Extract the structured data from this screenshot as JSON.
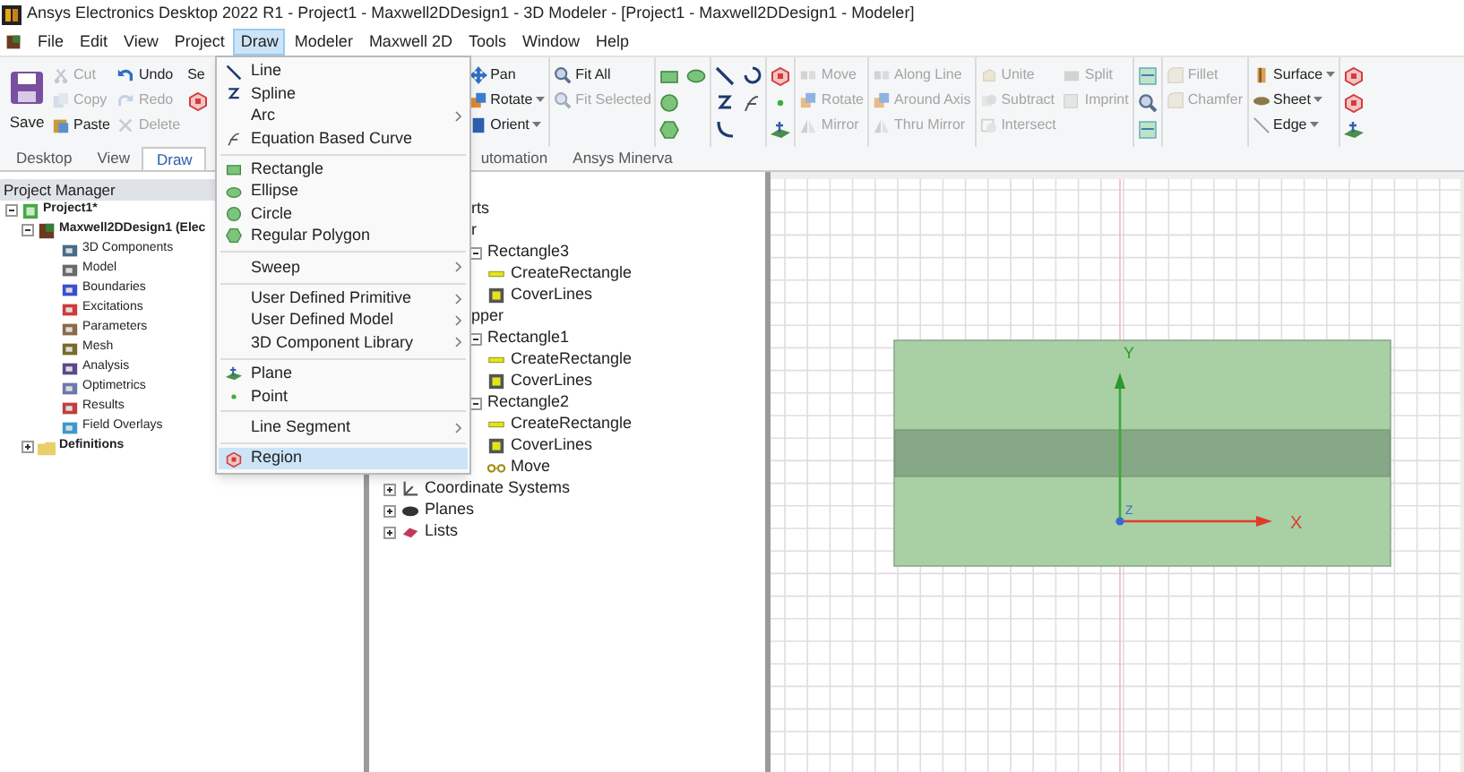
{
  "window": {
    "title": "Ansys Electronics Desktop 2022 R1 - Project1 - Maxwell2DDesign1 - 3D Modeler - [Project1 - Maxwell2DDesign1 - Modeler]"
  },
  "menu_bar": [
    {
      "label": "File",
      "selected": false
    },
    {
      "label": "Edit",
      "selected": false
    },
    {
      "label": "View",
      "selected": false
    },
    {
      "label": "Project",
      "selected": false
    },
    {
      "label": "Draw",
      "selected": true
    },
    {
      "label": "Modeler",
      "selected": false
    },
    {
      "label": "Maxwell 2D",
      "selected": false
    },
    {
      "label": "Tools",
      "selected": false
    },
    {
      "label": "Window",
      "selected": false
    },
    {
      "label": "Help",
      "selected": false
    }
  ],
  "ribbon": [
    {
      "sep": false,
      "items": [
        {
          "kind": "save",
          "label": "Save",
          "disabled": false,
          "large": true
        }
      ]
    },
    {
      "sep": false,
      "items": [
        {
          "kind": "cut",
          "label": "Cut",
          "disabled": true
        },
        {
          "kind": "copy",
          "label": "Copy",
          "disabled": true
        },
        {
          "kind": "paste",
          "label": "Paste",
          "disabled": false
        }
      ]
    },
    {
      "sep": false,
      "items": [
        {
          "kind": "undo",
          "label": "Undo",
          "disabled": false
        },
        {
          "kind": "redo",
          "label": "Redo",
          "disabled": true
        },
        {
          "kind": "delete",
          "label": "Delete",
          "disabled": true
        }
      ]
    },
    {
      "sep": false,
      "items": [
        {
          "kind": "none",
          "label": "Se",
          "disabled": false
        },
        {
          "kind": "region",
          "disabled": false
        }
      ]
    },
    {
      "sep": false,
      "gap": true,
      "items": [
        {
          "kind": "pan",
          "label": "Pan",
          "disabled": false
        },
        {
          "kind": "rotate",
          "label": "Rotate",
          "disabled": false,
          "dropdown": true
        },
        {
          "kind": "orient",
          "label": "Orient",
          "disabled": false,
          "dropdown": true
        }
      ]
    },
    {
      "sep": true,
      "items": [
        {
          "kind": "zoom",
          "label": "Fit All",
          "disabled": false
        },
        {
          "kind": "zoom",
          "label": "Fit Selected",
          "disabled": true
        }
      ]
    },
    {
      "sep": true,
      "items": [
        {
          "kind": "rect",
          "disabled": false
        },
        {
          "kind": "circle",
          "disabled": false
        },
        {
          "kind": "polygon",
          "disabled": false
        }
      ]
    },
    {
      "sep": false,
      "items": [
        {
          "kind": "ellipse",
          "disabled": false
        }
      ]
    },
    {
      "sep": true,
      "items": [
        {
          "kind": "line",
          "disabled": false
        },
        {
          "kind": "spline",
          "disabled": false
        },
        {
          "kind": "arc",
          "disabled": false
        }
      ]
    },
    {
      "sep": false,
      "items": [
        {
          "kind": "arc3",
          "disabled": false
        },
        {
          "kind": "equation",
          "disabled": false
        }
      ]
    },
    {
      "sep": true,
      "items": [
        {
          "kind": "region",
          "disabled": false
        },
        {
          "kind": "point",
          "disabled": false
        },
        {
          "kind": "plane",
          "disabled": false
        }
      ]
    },
    {
      "sep": true,
      "items": [
        {
          "kind": "move",
          "label": "Move",
          "disabled": true
        },
        {
          "kind": "rotate",
          "label": "Rotate",
          "disabled": true
        },
        {
          "kind": "mirror",
          "label": "Mirror",
          "disabled": true
        }
      ]
    },
    {
      "sep": true,
      "items": [
        {
          "kind": "move",
          "label": "Along Line",
          "disabled": true
        },
        {
          "kind": "rotate",
          "label": "Around Axis",
          "disabled": true
        },
        {
          "kind": "mirror",
          "label": "Thru Mirror",
          "disabled": true
        }
      ]
    },
    {
      "sep": true,
      "items": [
        {
          "kind": "unite",
          "label": "Unite",
          "disabled": true
        },
        {
          "kind": "subtract",
          "label": "Subtract",
          "disabled": true
        },
        {
          "kind": "intersect",
          "label": "Intersect",
          "disabled": true
        }
      ]
    },
    {
      "sep": false,
      "items": [
        {
          "kind": "split",
          "label": "Split",
          "disabled": true
        },
        {
          "kind": "imprint",
          "label": "Imprint",
          "disabled": true
        }
      ]
    },
    {
      "sep": true,
      "items": [
        {
          "kind": "view",
          "disabled": false
        },
        {
          "kind": "zoom",
          "disabled": false
        },
        {
          "kind": "view",
          "disabled": false
        }
      ]
    },
    {
      "sep": true,
      "items": [
        {
          "kind": "fillet",
          "label": "Fillet",
          "disabled": true
        },
        {
          "kind": "fillet",
          "label": "Chamfer",
          "disabled": true
        }
      ]
    },
    {
      "sep": true,
      "items": [
        {
          "kind": "surface",
          "label": "Surface",
          "disabled": false,
          "dropdown": true
        },
        {
          "kind": "sheet",
          "label": "Sheet",
          "disabled": false,
          "dropdown": true
        },
        {
          "kind": "edge",
          "label": "Edge",
          "disabled": false,
          "dropdown": true
        }
      ]
    },
    {
      "sep": true,
      "items": [
        {
          "kind": "region",
          "disabled": false
        },
        {
          "kind": "region",
          "disabled": false
        },
        {
          "kind": "plane",
          "disabled": false
        }
      ]
    }
  ],
  "ribbon_tabs": [
    {
      "label": "Desktop",
      "selected": false
    },
    {
      "label": "View",
      "selected": false
    },
    {
      "label": "Draw",
      "selected": true
    },
    {
      "label": "utomation",
      "selected": false,
      "gap": true
    },
    {
      "label": "Ansys Minerva",
      "selected": false
    }
  ],
  "project_manager": {
    "title": "Project Manager",
    "tree": [
      {
        "label": "Project1*",
        "kind": "project",
        "expanded": true,
        "children": [
          {
            "label": "Maxwell2DDesign1 (Elec",
            "kind": "design",
            "expanded": true,
            "children": [
              {
                "label": "3D Components",
                "kind": "components"
              },
              {
                "label": "Model",
                "kind": "model"
              },
              {
                "label": "Boundaries",
                "kind": "boundaries"
              },
              {
                "label": "Excitations",
                "kind": "excitations"
              },
              {
                "label": "Parameters",
                "kind": "parameters"
              },
              {
                "label": "Mesh",
                "kind": "mesh"
              },
              {
                "label": "Analysis",
                "kind": "analysis"
              },
              {
                "label": "Optimetrics",
                "kind": "optimetrics"
              },
              {
                "label": "Results",
                "kind": "results"
              },
              {
                "label": "Field Overlays",
                "kind": "overlays"
              }
            ]
          },
          {
            "label": "Definitions",
            "kind": "folder",
            "expanded": false
          }
        ]
      }
    ]
  },
  "model_tree": [
    {
      "label": "rts",
      "kind": "fragment",
      "children": [
        {
          "label": "r",
          "kind": "fragment",
          "children": [
            {
              "label": "Rectangle3",
              "kind": "node",
              "expanded": true,
              "children": [
                {
                  "label": "CreateRectangle",
                  "kind": "create"
                },
                {
                  "label": "CoverLines",
                  "kind": "cover"
                }
              ]
            }
          ]
        },
        {
          "label": "pper",
          "kind": "fragment",
          "children": [
            {
              "label": "Rectangle1",
              "kind": "node",
              "expanded": true,
              "children": [
                {
                  "label": "CreateRectangle",
                  "kind": "create"
                },
                {
                  "label": "CoverLines",
                  "kind": "cover"
                }
              ]
            },
            {
              "label": "Rectangle2",
              "kind": "node",
              "expanded": true,
              "children": [
                {
                  "label": "CreateRectangle",
                  "kind": "create"
                },
                {
                  "label": "CoverLines",
                  "kind": "cover"
                },
                {
                  "label": "Move",
                  "kind": "move"
                }
              ]
            }
          ]
        }
      ]
    },
    {
      "label": "Coordinate Systems",
      "kind": "coords",
      "expanded": false
    },
    {
      "label": "Planes",
      "kind": "planes",
      "expanded": false
    },
    {
      "label": "Lists",
      "kind": "lists",
      "expanded": false
    }
  ],
  "draw_menu": [
    {
      "kind": "line",
      "label": "Line",
      "submenu": false,
      "selected": false
    },
    {
      "kind": "spline",
      "label": "Spline",
      "submenu": false,
      "selected": false
    },
    {
      "kind": "none",
      "label": "Arc",
      "submenu": true,
      "selected": false
    },
    {
      "kind": "equation",
      "label": "Equation Based Curve",
      "submenu": false,
      "selected": false
    },
    {
      "kind": "separator"
    },
    {
      "kind": "rect",
      "label": "Rectangle",
      "submenu": false,
      "selected": false
    },
    {
      "kind": "ellipse",
      "label": "Ellipse",
      "submenu": false,
      "selected": false
    },
    {
      "kind": "circle",
      "label": "Circle",
      "submenu": false,
      "selected": false
    },
    {
      "kind": "polygon",
      "label": "Regular Polygon",
      "submenu": false,
      "selected": false
    },
    {
      "kind": "separator"
    },
    {
      "kind": "none",
      "label": "Sweep",
      "submenu": true,
      "selected": false
    },
    {
      "kind": "separator"
    },
    {
      "kind": "none",
      "label": "User Defined Primitive",
      "submenu": true,
      "selected": false
    },
    {
      "kind": "none",
      "label": "User Defined Model",
      "submenu": true,
      "selected": false
    },
    {
      "kind": "none",
      "label": "3D Component Library",
      "submenu": true,
      "selected": false
    },
    {
      "kind": "separator"
    },
    {
      "kind": "plane",
      "label": "Plane",
      "submenu": false,
      "selected": false
    },
    {
      "kind": "point",
      "label": "Point",
      "submenu": false,
      "selected": false
    },
    {
      "kind": "separator"
    },
    {
      "kind": "none",
      "label": "Line Segment",
      "submenu": true,
      "selected": false
    },
    {
      "kind": "separator"
    },
    {
      "kind": "region",
      "label": "Region",
      "submenu": false,
      "selected": true
    }
  ],
  "viewport": {
    "axes": [
      {
        "kind": "y",
        "label": "Y"
      },
      {
        "kind": "x",
        "label": "X"
      },
      {
        "kind": "z",
        "label": "Z"
      }
    ]
  }
}
